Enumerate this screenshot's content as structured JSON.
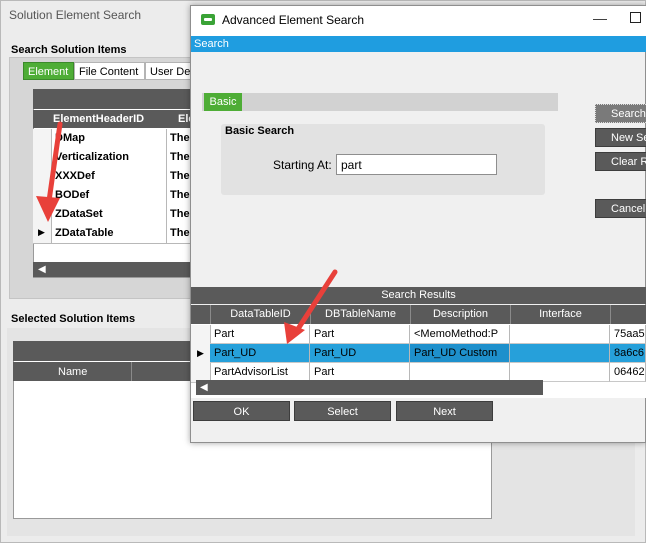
{
  "background_window": {
    "title": "Solution Element Search",
    "search_section_label": "Search Solution Items",
    "tabs": [
      "Element",
      "File Content",
      "User Def"
    ],
    "grid": {
      "header": [
        "ElementHeaderID",
        "Ele"
      ],
      "rows": [
        {
          "id": "DMap",
          "desc": "The"
        },
        {
          "id": "Verticalization",
          "desc": "The"
        },
        {
          "id": "XXXDef",
          "desc": "The"
        },
        {
          "id": "BODef",
          "desc": "The"
        },
        {
          "id": "ZDataSet",
          "desc": "The"
        },
        {
          "id": "ZDataTable",
          "desc": "The"
        }
      ],
      "current_row_marker": "▶"
    },
    "selected_section_label": "Selected Solution Items",
    "selected_grid_header": [
      "Name"
    ]
  },
  "dialog": {
    "title": "Advanced Element Search",
    "menu": [
      "Search"
    ],
    "tabs": [
      "Basic"
    ],
    "basic_search": {
      "group_label": "Basic Search",
      "starting_at_label": "Starting At:",
      "starting_at_value": "part"
    },
    "side_buttons": {
      "search": "Search",
      "new_search": "New Search",
      "clear": "Clear Results",
      "cancel": "Cancel"
    },
    "results": {
      "title": "Search Results",
      "columns": [
        "DataTableID",
        "DBTableName",
        "Description",
        "Interface",
        ""
      ],
      "rows": [
        {
          "DataTableID": "Part",
          "DBTableName": "Part",
          "Description": "<MemoMethod:P",
          "Interface": "",
          "Key": "75aa5"
        },
        {
          "DataTableID": "Part_UD",
          "DBTableName": "Part_UD",
          "Description": "Part_UD Custom",
          "Interface": "",
          "Key": "8a6c6"
        },
        {
          "DataTableID": "PartAdvisorList",
          "DBTableName": "Part",
          "Description": "",
          "Interface": "",
          "Key": "06462"
        }
      ],
      "selected_index": 1,
      "current_row_marker": "▶"
    },
    "bottom_buttons": {
      "ok": "OK",
      "select": "Select",
      "next": "Next"
    }
  },
  "colors": {
    "accent_green": "#4ead36",
    "menu_blue": "#1f9de0",
    "selection_blue": "#26a0da",
    "annotation_red": "#e8403a"
  }
}
